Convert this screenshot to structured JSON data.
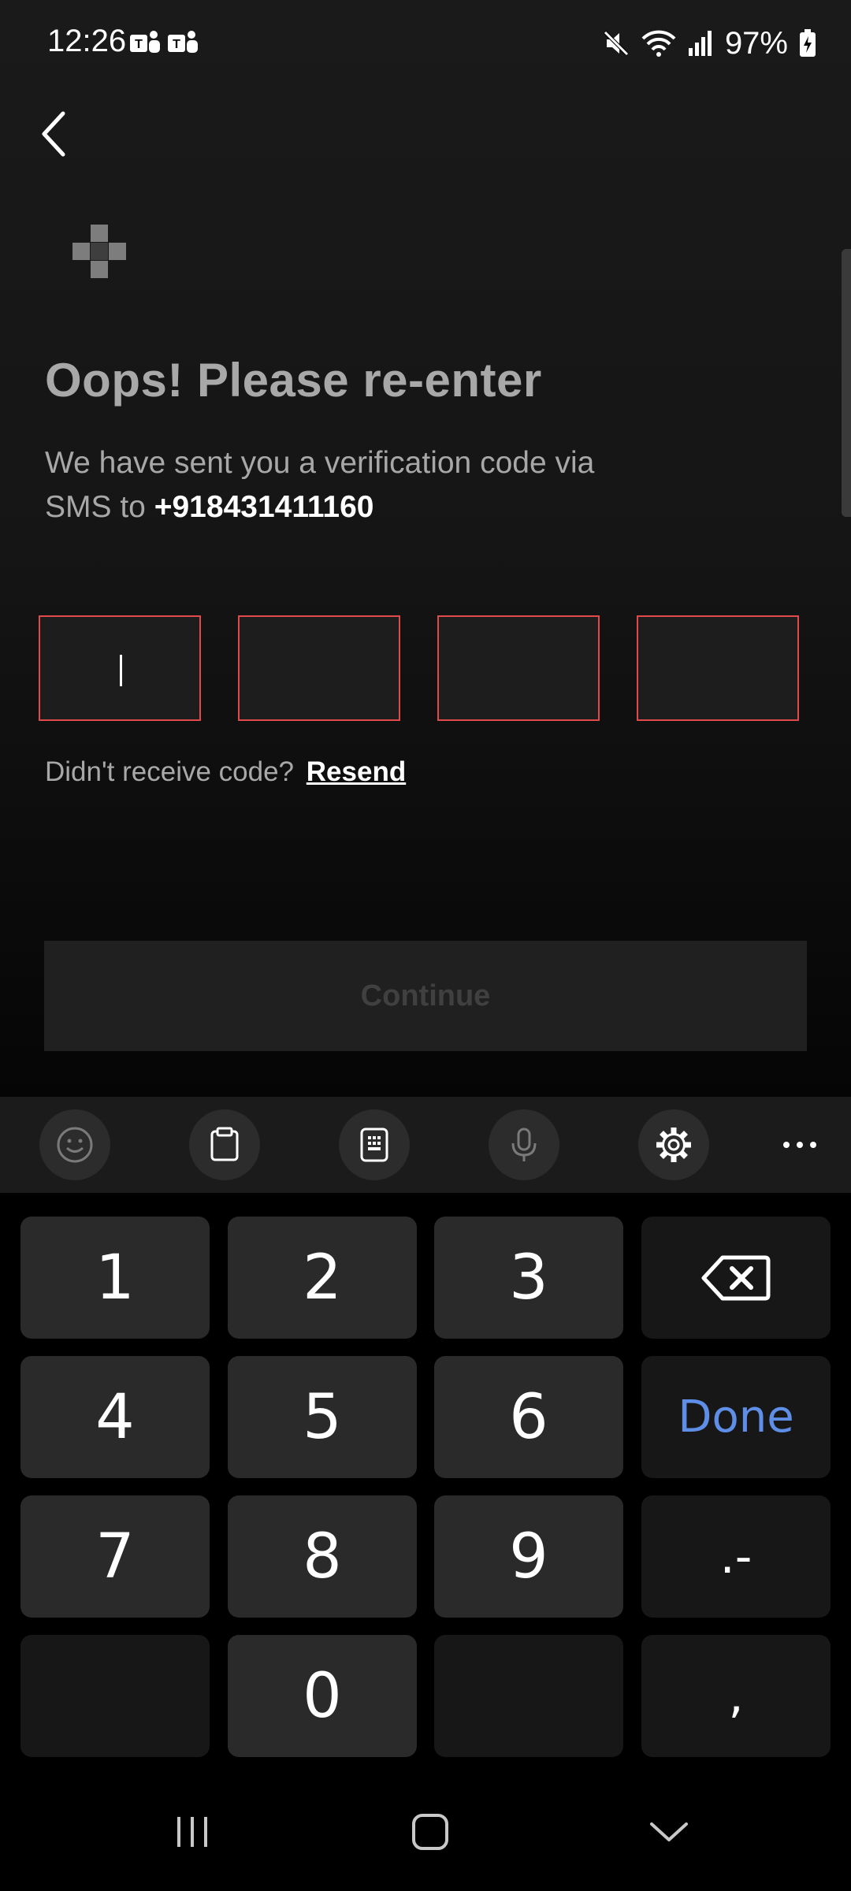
{
  "status_bar": {
    "time": "12:26",
    "battery": "97%",
    "icons": [
      "teams-icon",
      "teams-icon",
      "mute-icon",
      "wifi-icon",
      "signal-icon",
      "battery-charging-icon"
    ]
  },
  "header": {
    "back_icon": "chevron-left-icon"
  },
  "logo_icon": "checker-logo-icon",
  "title": "Oops! Please re-enter",
  "subtitle": {
    "prefix": "We have sent you a verification code via  SMS  to ",
    "phone": "+918431411160"
  },
  "otp": {
    "boxes": [
      "",
      "",
      "",
      ""
    ],
    "error_color": "#e04a4a"
  },
  "resend": {
    "question": "Didn't receive code?",
    "link": "Resend"
  },
  "continue_label": "Continue",
  "keyboard_toolbar": {
    "icons": [
      "emoji-icon",
      "clipboard-icon",
      "keypad-icon",
      "microphone-icon",
      "settings-icon",
      "more-icon"
    ]
  },
  "keyboard": {
    "rows": [
      [
        "1",
        "2",
        "3",
        "⌫"
      ],
      [
        "4",
        "5",
        "6",
        "Done"
      ],
      [
        "7",
        "8",
        "9",
        ".-"
      ],
      [
        "",
        "0",
        "",
        ","
      ]
    ],
    "done_color": "#5e8ee6"
  },
  "nav_bar": {
    "icons": [
      "recents-icon",
      "home-icon",
      "back-nav-icon"
    ]
  }
}
